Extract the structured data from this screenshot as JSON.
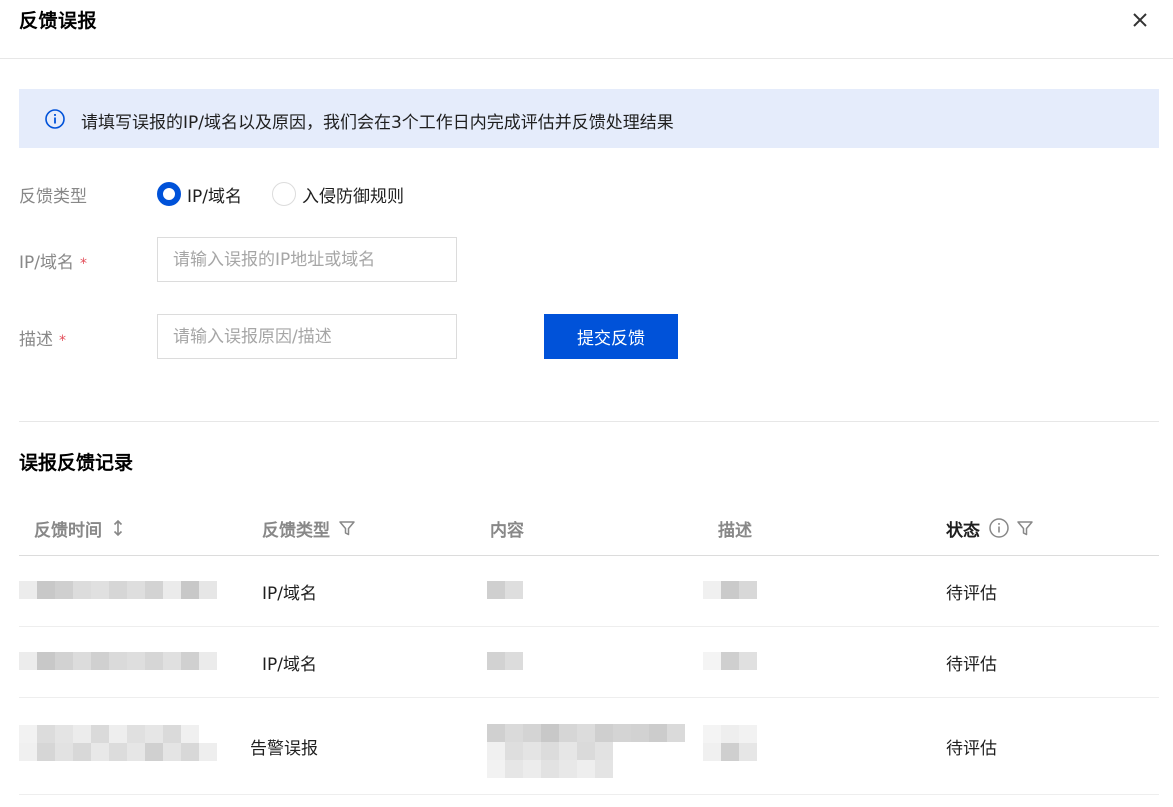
{
  "dialog": {
    "title": "反馈误报"
  },
  "alert": {
    "text": "请填写误报的IP/域名以及原因，我们会在3个工作日内完成评估并反馈处理结果"
  },
  "form": {
    "type_label": "反馈类型",
    "type_options": [
      {
        "label": "IP/域名",
        "checked": true
      },
      {
        "label": "入侵防御规则",
        "checked": false
      }
    ],
    "ip_label": "IP/域名",
    "ip_placeholder": "请输入误报的IP地址或域名",
    "ip_value": "",
    "desc_label": "描述",
    "desc_placeholder": "请输入误报原因/描述",
    "desc_value": "",
    "required_mark": "*",
    "submit_label": "提交反馈"
  },
  "records": {
    "title": "误报反馈记录",
    "columns": [
      "反馈时间",
      "反馈类型",
      "内容",
      "描述",
      "状态"
    ],
    "rows": [
      {
        "type": "IP/域名",
        "status": "待评估"
      },
      {
        "type": "IP/域名",
        "status": "待评估"
      },
      {
        "type": "告警误报",
        "status": "待评估"
      }
    ]
  },
  "icons": {
    "close": "close-icon",
    "info": "info-circle-icon",
    "sort": "sort-icon",
    "filter": "filter-icon"
  },
  "colors": {
    "primary": "#0052d9",
    "alert_bg": "#e5ecfb",
    "required": "#e34d59",
    "muted_text": "#888888"
  }
}
